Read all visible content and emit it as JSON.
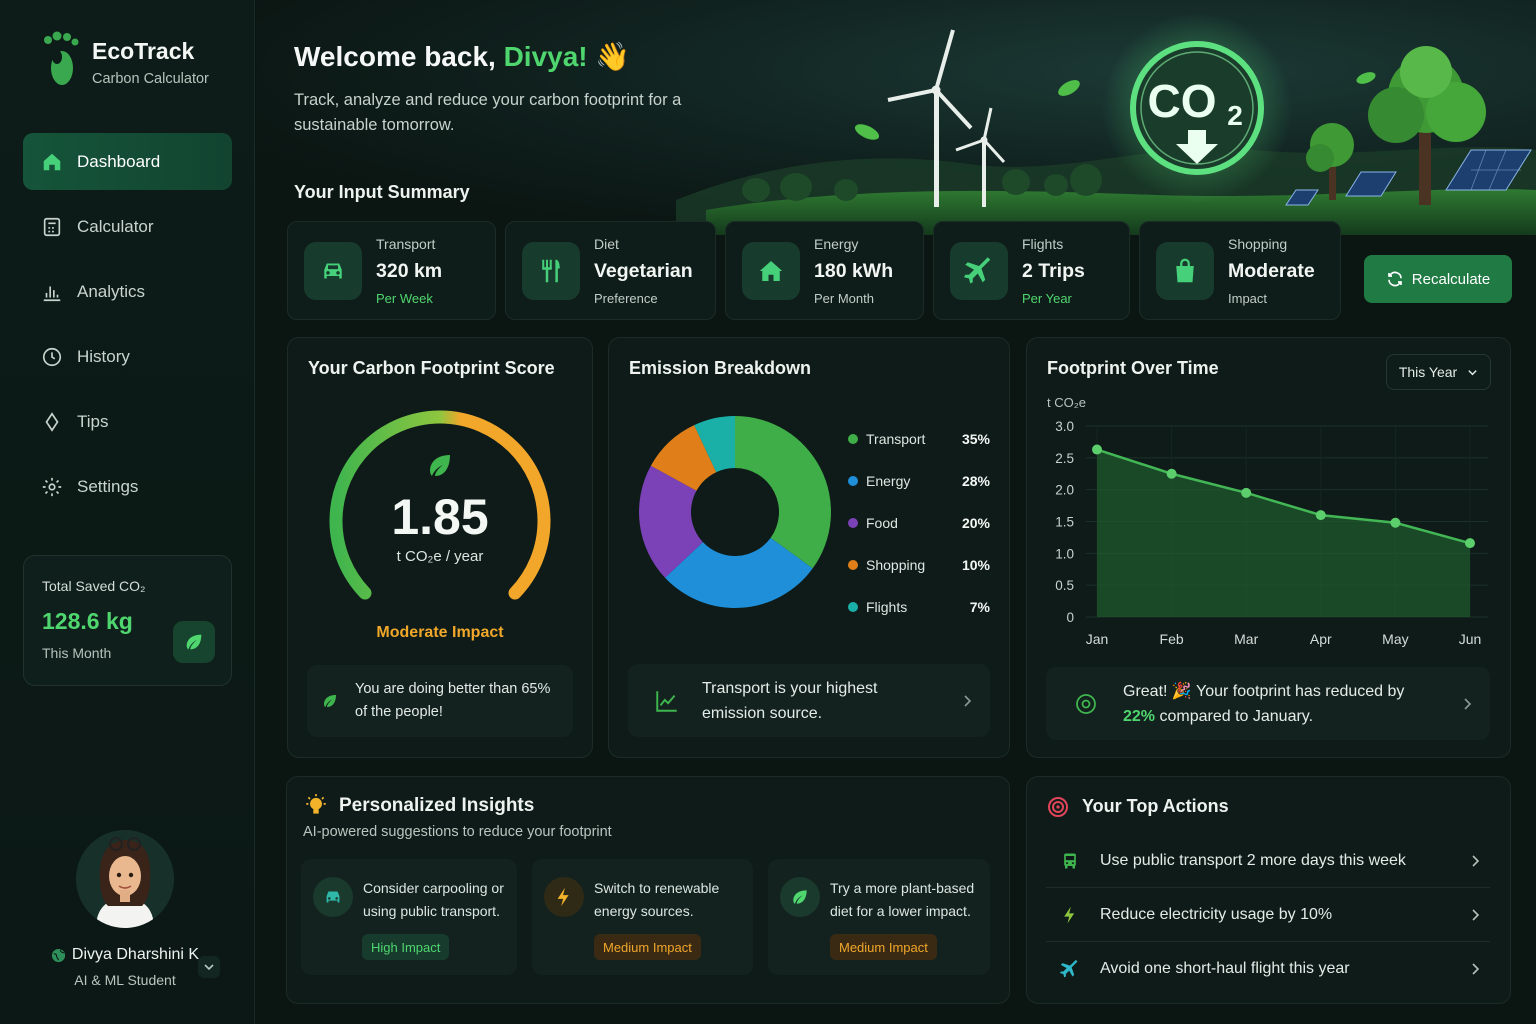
{
  "brand": {
    "name": "EcoTrack",
    "subtitle": "Carbon Calculator"
  },
  "nav": [
    {
      "label": "Dashboard",
      "icon": "home-icon",
      "active": true
    },
    {
      "label": "Calculator",
      "icon": "calculator-icon",
      "active": false
    },
    {
      "label": "Analytics",
      "icon": "bar-chart-icon",
      "active": false
    },
    {
      "label": "History",
      "icon": "clock-icon",
      "active": false
    },
    {
      "label": "Tips",
      "icon": "diamond-icon",
      "active": false
    },
    {
      "label": "Settings",
      "icon": "gear-icon",
      "active": false
    }
  ],
  "saved": {
    "label": "Total Saved CO₂",
    "value": "128.6 kg",
    "period": "This Month"
  },
  "profile": {
    "name": "Divya Dharshini K",
    "role": "AI & ML Student"
  },
  "header": {
    "welcome_prefix": "Welcome back,",
    "user_name": "Divya!",
    "wave": "👋",
    "tagline": "Track, analyze and reduce your carbon footprint for a sustainable tomorrow.",
    "co2_badge": "CO₂"
  },
  "summary": {
    "title": "Your Input Summary",
    "items": [
      {
        "label": "Transport",
        "value": "320 km",
        "sub": "Per Week",
        "icon": "car-icon"
      },
      {
        "label": "Diet",
        "value": "Vegetarian",
        "sub": "Preference",
        "icon": "utensils-icon"
      },
      {
        "label": "Energy",
        "value": "180 kWh",
        "sub": "Per Month",
        "icon": "house-icon"
      },
      {
        "label": "Flights",
        "value": "2 Trips",
        "sub": "Per Year",
        "icon": "plane-icon"
      },
      {
        "label": "Shopping",
        "value": "Moderate",
        "sub": "Impact",
        "icon": "shopping-bag-icon"
      }
    ],
    "recalc_label": "Recalculate"
  },
  "score": {
    "title": "Your Carbon Footprint Score",
    "value": "1.85",
    "unit": "t CO₂e / year",
    "impact": "Moderate Impact",
    "note": "You are doing better than 65% of the people!"
  },
  "breakdown": {
    "title": "Emission Breakdown",
    "note": "Transport is your highest emission source."
  },
  "chart_data": [
    {
      "type": "pie",
      "title": "Emission Breakdown",
      "categories": [
        "Transport",
        "Energy",
        "Food",
        "Shopping",
        "Flights"
      ],
      "values": [
        35,
        28,
        20,
        10,
        7
      ],
      "labels": [
        "35%",
        "28%",
        "20%",
        "10%",
        "7%"
      ],
      "colors": [
        "#3fae48",
        "#1e8fd8",
        "#7b42b8",
        "#e07f1a",
        "#1ab0a8"
      ],
      "legend": "right"
    },
    {
      "type": "area",
      "title": "Footprint Over Time",
      "ylabel": "t CO₂e",
      "categories": [
        "Jan",
        "Feb",
        "Mar",
        "Apr",
        "May",
        "Jun"
      ],
      "values": [
        2.63,
        2.25,
        1.95,
        1.6,
        1.48,
        1.16
      ],
      "yticks": [
        "3.0",
        "2.5",
        "2.0",
        "1.5",
        "1.0",
        "0.5",
        "0"
      ],
      "ylim": [
        0,
        3.0
      ],
      "grid": true,
      "color": "#43b756"
    }
  ],
  "over_time": {
    "title": "Footprint Over Time",
    "period": "This Year",
    "ylabel": "t CO₂e",
    "note_prefix": "Great! 🎉 Your footprint has reduced by",
    "note_pct": "22%",
    "note_suffix": "compared to January."
  },
  "insights": {
    "title": "Personalized Insights",
    "subtitle": "AI-powered suggestions to reduce your footprint",
    "items": [
      {
        "text": "Consider carpooling or using public transport.",
        "badge": "High Impact",
        "icon": "car-icon"
      },
      {
        "text": "Switch to renewable energy sources.",
        "badge": "Medium Impact",
        "icon": "lightning-icon"
      },
      {
        "text": "Try a more plant-based diet for a lower impact.",
        "badge": "Medium Impact",
        "icon": "leaf-icon"
      }
    ]
  },
  "actions": {
    "title": "Your Top Actions",
    "items": [
      {
        "text": "Use public transport 2 more days this week",
        "icon": "bus-icon"
      },
      {
        "text": "Reduce electricity usage by 10%",
        "icon": "lightning-icon"
      },
      {
        "text": "Avoid one short-haul flight this year",
        "icon": "plane-icon"
      }
    ]
  }
}
